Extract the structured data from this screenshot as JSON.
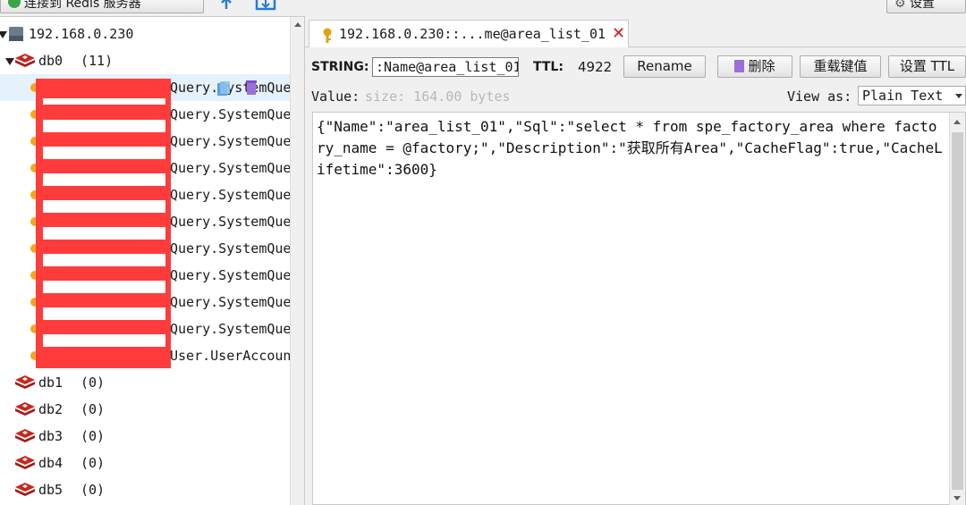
{
  "toolbar": {
    "connect_label": "连接到 Redis 服务器",
    "settings_label": "设置"
  },
  "tree": {
    "server": "192.168.0.230",
    "db0": {
      "name": "db0",
      "count": "(11)"
    },
    "keys": [
      "Query.SystemQue",
      "Query.SystemQue",
      "Query.SystemQue",
      "Query.SystemQue",
      "Query.SystemQue",
      "Query.SystemQue",
      "Query.SystemQue",
      "Query.SystemQue",
      "Query.SystemQue",
      "Query.SystemQue",
      "User.UserAccoun"
    ],
    "databases": [
      {
        "name": "db1",
        "count": "(0)"
      },
      {
        "name": "db2",
        "count": "(0)"
      },
      {
        "name": "db3",
        "count": "(0)"
      },
      {
        "name": "db4",
        "count": "(0)"
      },
      {
        "name": "db5",
        "count": "(0)"
      }
    ]
  },
  "tab": {
    "title": "192.168.0.230::...me@area_list_01",
    "close": "✕"
  },
  "key_view": {
    "type_label": "STRING:",
    "key_value": ":Name@area_list_01",
    "ttl_label": "TTL:",
    "ttl_value": "4922",
    "rename_label": "Rename",
    "delete_label": "删除",
    "reload_label": "重载键值",
    "set_ttl_label": "设置 TTL",
    "value_label": "Value:",
    "value_size": "size: 164.00 bytes",
    "view_as_label": "View as:",
    "view_as_value": "Plain Text",
    "content": "{\"Name\":\"area_list_01\",\"Sql\":\"select * from spe_factory_area where factory_name = @factory;\",\"Description\":\"获取所有Area\",\"CacheFlag\":true,\"CacheLifetime\":3600}"
  },
  "colors": {
    "redaction": "#ff3b3b",
    "redis_red": "#c8261f",
    "key_orange": "#f3a523",
    "selection": "#e5f1fb"
  }
}
